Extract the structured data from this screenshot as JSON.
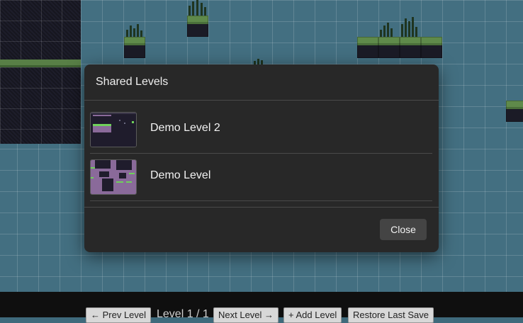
{
  "modal": {
    "title": "Shared Levels",
    "levels": [
      {
        "name": "Demo Level 2"
      },
      {
        "name": "Demo Level"
      }
    ],
    "close_label": "Close"
  },
  "toolbar": {
    "prev_label": "← Prev Level",
    "level_indicator": "Level 1 / 1",
    "next_label": "Next Level →",
    "add_label": "+ Add Level",
    "restore_label": "Restore Last Save"
  },
  "colors": {
    "sky": "#436f81",
    "modal_bg": "#282828",
    "accent_green": "#6fd05a",
    "thumb_purple": "#8a6a9a",
    "thumb_dark": "#1f1c2c"
  }
}
